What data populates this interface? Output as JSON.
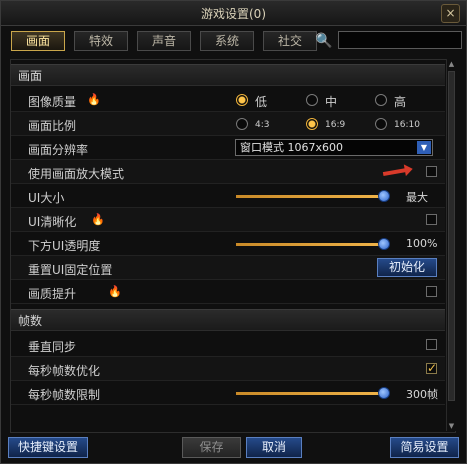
{
  "window": {
    "title": "游戏设置(0)",
    "close_label": "×"
  },
  "tabs": [
    "画面",
    "特效",
    "声音",
    "系统",
    "社交"
  ],
  "search": {
    "value": "",
    "placeholder": ""
  },
  "sections": {
    "graphics": "画面",
    "fps": "帧数"
  },
  "graphics": {
    "quality": {
      "label": "图像质量",
      "options": [
        "低",
        "中",
        "高"
      ],
      "selected": "低"
    },
    "ratio": {
      "label": "画面比例",
      "options": [
        "4:3",
        "16:9",
        "16:10"
      ],
      "selected": "16:9"
    },
    "resolution": {
      "label": "画面分辨率",
      "value": "窗口模式 1067x600"
    },
    "magnify": {
      "label": "使用画面放大模式",
      "checked": false
    },
    "ui_size": {
      "label": "UI大小",
      "value_label": "最大",
      "level": 1.0
    },
    "ui_sharpen": {
      "label": "UI清晰化",
      "checked": false
    },
    "bottom_ui_alpha": {
      "label": "下方UI透明度",
      "value_label": "100%",
      "level": 1.0
    },
    "reset_ui": {
      "label": "重置UI固定位置",
      "button": "初始化"
    },
    "enhance": {
      "label": "画质提升",
      "checked": false
    }
  },
  "fps": {
    "vsync": {
      "label": "垂直同步",
      "checked": false
    },
    "optimize": {
      "label": "每秒帧数优化",
      "checked": true
    },
    "limit": {
      "label": "每秒帧数限制",
      "value_label": "300帧",
      "level": 1.0
    }
  },
  "footer": {
    "shortcut": "快捷键设置",
    "save": "保存",
    "cancel": "取消",
    "simple": "简易设置"
  }
}
